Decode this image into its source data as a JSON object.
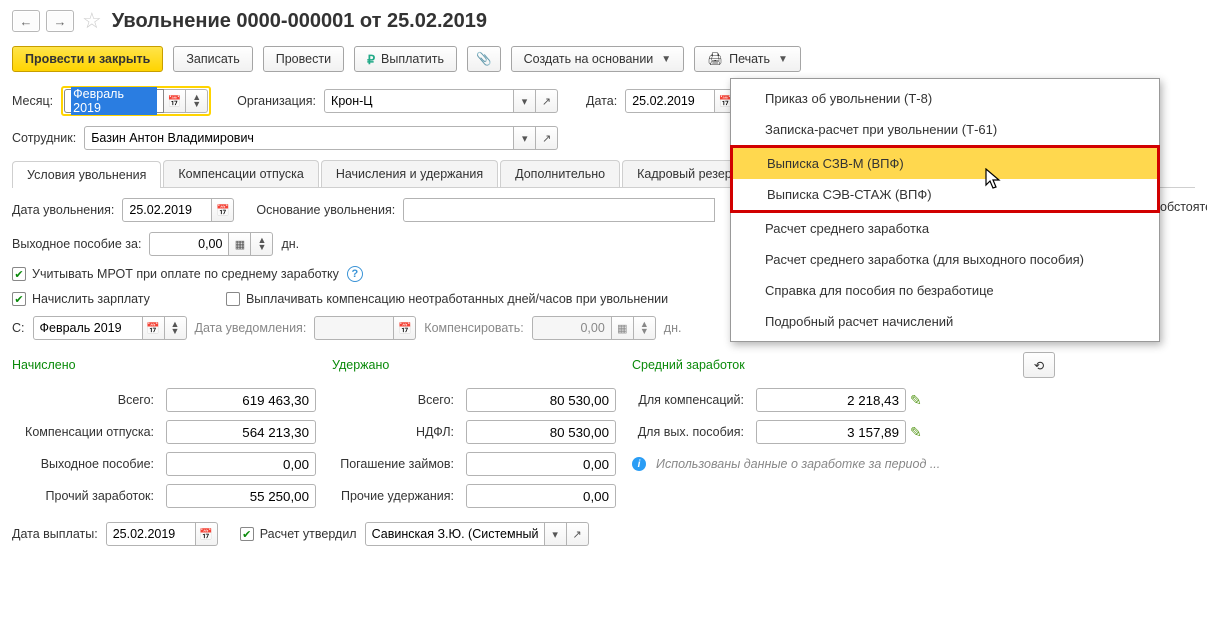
{
  "header": {
    "title": "Увольнение 0000-000001 от 25.02.2019"
  },
  "toolbar": {
    "run_close": "Провести и закрыть",
    "write": "Записать",
    "run": "Провести",
    "pay": "Выплатить",
    "create_based": "Создать на основании",
    "print": "Печать"
  },
  "line1": {
    "month_lbl": "Месяц:",
    "month_val": "Февраль 2019",
    "org_lbl": "Организация:",
    "org_val": "Крон-Ц",
    "date_lbl": "Дата:",
    "date_val": "25.02.2019"
  },
  "line2": {
    "emp_lbl": "Сотрудник:",
    "emp_val": "Базин Антон Владимирович"
  },
  "tabs": {
    "t1": "Условия увольнения",
    "t2": "Компенсации отпуска",
    "t3": "Начисления и удержания",
    "t4": "Дополнительно",
    "t5": "Кадровый резерв"
  },
  "cond": {
    "fire_date_lbl": "Дата увольнения:",
    "fire_date_val": "25.02.2019",
    "basis_lbl": "Основание увольнения:",
    "sev_lbl": "Выходное пособие за:",
    "sev_val": "0,00",
    "sev_unit": "дн.",
    "mrot_lbl": "Учитывать МРОТ при оплате по среднему заработку",
    "accrue_lbl": "Начислить зарплату",
    "paycomp_lbl": "Выплачивать компенсацию неотработанных дней/часов при увольнении",
    "from_lbl": "С:",
    "from_val": "Февраль 2019",
    "notify_lbl": "Дата уведомления:",
    "comp_lbl": "Компенсировать:",
    "comp_val": "0,00",
    "comp_unit": "дн."
  },
  "sections": {
    "accrued": "Начислено",
    "withheld": "Удержано",
    "avg": "Средний заработок"
  },
  "accrued": {
    "total_lbl": "Всего:",
    "total": "619 463,30",
    "vac_lbl": "Компенсации отпуска:",
    "vac": "564 213,30",
    "sev_lbl": "Выходное пособие:",
    "sev": "0,00",
    "oth_lbl": "Прочий заработок:",
    "oth": "55 250,00"
  },
  "withheld": {
    "total_lbl": "Всего:",
    "total": "80 530,00",
    "ndfl_lbl": "НДФЛ:",
    "ndfl": "80 530,00",
    "loan_lbl": "Погашение займов:",
    "loan": "0,00",
    "oth_lbl": "Прочие удержания:",
    "oth": "0,00"
  },
  "avg": {
    "comp_lbl": "Для компенсаций:",
    "comp": "2 218,43",
    "sev_lbl": "Для вых. пособия:",
    "sev": "3 157,89",
    "info": "Использованы данные о заработке за период ..."
  },
  "footer": {
    "paydate_lbl": "Дата выплаты:",
    "paydate_val": "25.02.2019",
    "approved_lbl": "Расчет утвердил",
    "approver": "Савинская З.Ю. (Системный п"
  },
  "print_menu": {
    "i1": "Приказ об увольнении (Т-8)",
    "i2": "Записка-расчет при увольнении (Т-61)",
    "i3": "Выписка СЗВ-М (ВПФ)",
    "i4": "Выписка СЭВ-СТАЖ (ВПФ)",
    "i5": "Расчет среднего заработка",
    "i6": "Расчет среднего заработка (для выходного пособия)",
    "i7": "Справка для пособия по безработице",
    "i8": "Подробный расчет начислений"
  },
  "cut_text": "обстоятел"
}
